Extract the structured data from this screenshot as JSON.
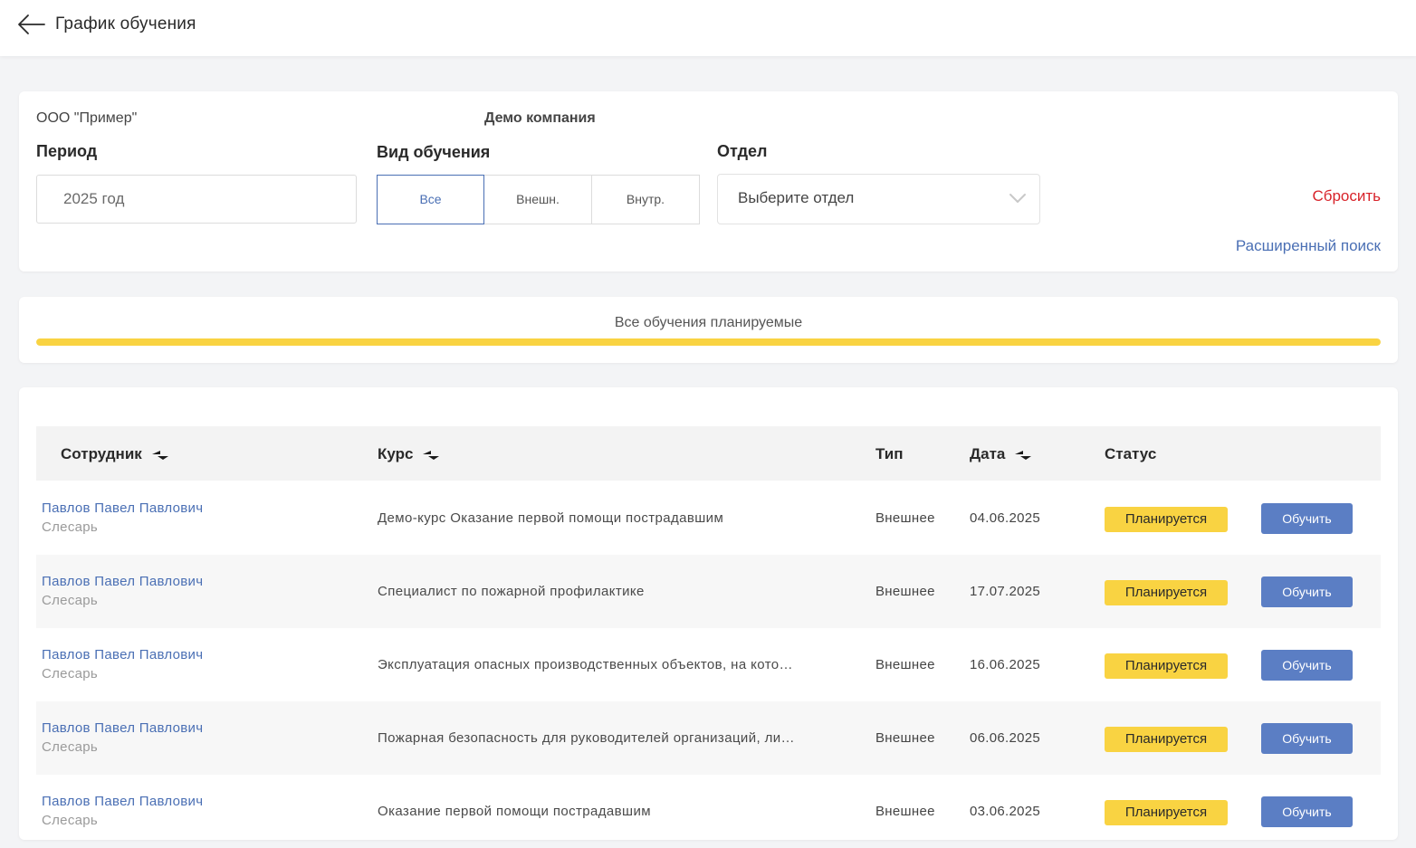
{
  "header": {
    "title": "График обучения"
  },
  "filters": {
    "org_name": "ООО \"Пример\"",
    "company_name": "Демо компания",
    "period_label": "Период",
    "period_value": "2025 год",
    "type_label": "Вид обучения",
    "type_options": [
      "Все",
      "Внешн.",
      "Внутр."
    ],
    "type_selected": "Все",
    "dept_label": "Отдел",
    "dept_placeholder": "Выберите отдел",
    "reset": "Сбросить",
    "advanced_search": "Расширенный поиск"
  },
  "summary": {
    "label": "Все обучения планируемые",
    "progress": 1.0
  },
  "table": {
    "columns": [
      "Сотрудник",
      "Курс",
      "Тип",
      "Дата",
      "Статус"
    ],
    "rows": [
      {
        "employee": "Павлов Павел Павлович",
        "position": "Слесарь",
        "course": "Демо-курс Оказание первой помощи пострадавшим",
        "type": "Внешнее",
        "date": "04.06.2025",
        "status": "Планируется",
        "action": "Обучить"
      },
      {
        "employee": "Павлов Павел Павлович",
        "position": "Слесарь",
        "course": "Специалист по пожарной профилактике",
        "type": "Внешнее",
        "date": "17.07.2025",
        "status": "Планируется",
        "action": "Обучить"
      },
      {
        "employee": "Павлов Павел Павлович",
        "position": "Слесарь",
        "course": "Эксплуатация опасных производственных объектов, на кото…",
        "type": "Внешнее",
        "date": "16.06.2025",
        "status": "Планируется",
        "action": "Обучить"
      },
      {
        "employee": "Павлов Павел Павлович",
        "position": "Слесарь",
        "course": "Пожарная безопасность для руководителей организаций, ли…",
        "type": "Внешнее",
        "date": "06.06.2025",
        "status": "Планируется",
        "action": "Обучить"
      },
      {
        "employee": "Павлов Павел Павлович",
        "position": "Слесарь",
        "course": "Оказание первой помощи пострадавшим",
        "type": "Внешнее",
        "date": "03.06.2025",
        "status": "Планируется",
        "action": "Обучить"
      }
    ]
  },
  "icons": {
    "back": "arrow-left-icon",
    "dropdown": "chevron-down-icon",
    "sort": "sort-icon"
  },
  "colors": {
    "accent": "#4a6fb4",
    "status": "#f9d342",
    "reset": "#d8232a",
    "button": "#5b7ec4"
  }
}
